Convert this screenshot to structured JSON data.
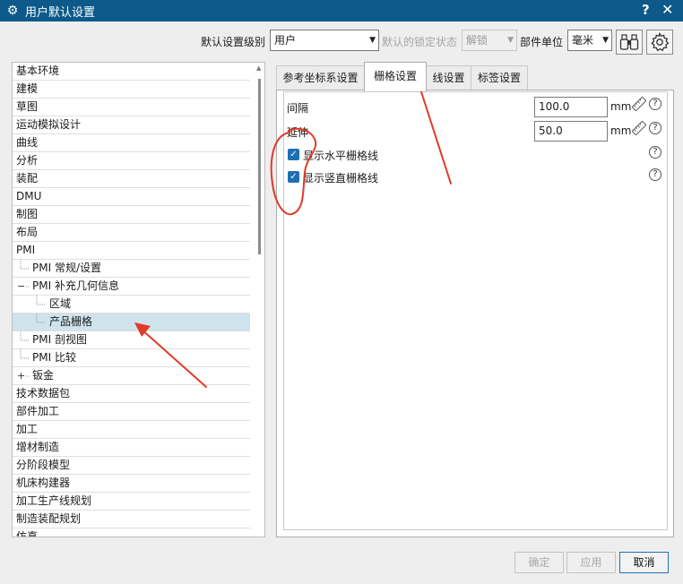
{
  "window": {
    "title": "用户默认设置",
    "title_icon": "gear-icon",
    "help": "?",
    "close": "✕"
  },
  "toolbar": {
    "level_label": "默认设置级别",
    "level_value": "用户",
    "lock_label": "默认的锁定状态",
    "lock_value": "解锁",
    "unit_label": "部件单位",
    "unit_value": "毫米",
    "find_icon": "binoculars-icon",
    "settings_icon": "gear-icon"
  },
  "tree": {
    "items": [
      {
        "label": "基本环境",
        "level": 0
      },
      {
        "label": "建模",
        "level": 0
      },
      {
        "label": "草图",
        "level": 0
      },
      {
        "label": "运动模拟设计",
        "level": 0
      },
      {
        "label": "曲线",
        "level": 0
      },
      {
        "label": "分析",
        "level": 0
      },
      {
        "label": "装配",
        "level": 0
      },
      {
        "label": "DMU",
        "level": 0
      },
      {
        "label": "制图",
        "level": 0
      },
      {
        "label": "布局",
        "level": 0
      },
      {
        "label": "PMI",
        "level": 0
      },
      {
        "label": "PMI 常规/设置",
        "level": 1
      },
      {
        "label": "PMI 补充几何信息",
        "level": 1,
        "expander": "−"
      },
      {
        "label": "区域",
        "level": 2
      },
      {
        "label": "产品栅格",
        "level": 2,
        "selected": true
      },
      {
        "label": "PMI 剖视图",
        "level": 1
      },
      {
        "label": "PMI 比较",
        "level": 1
      },
      {
        "label": "钣金",
        "level": 1,
        "expander": "+"
      },
      {
        "label": "技术数据包",
        "level": 0
      },
      {
        "label": "部件加工",
        "level": 0
      },
      {
        "label": "加工",
        "level": 0
      },
      {
        "label": "增材制造",
        "level": 0
      },
      {
        "label": "分阶段模型",
        "level": 0
      },
      {
        "label": "机床构建器",
        "level": 0
      },
      {
        "label": "加工生产线规划",
        "level": 0
      },
      {
        "label": "制造装配规划",
        "level": 0
      },
      {
        "label": "仿真",
        "level": 0
      }
    ]
  },
  "tabs": [
    {
      "label": "参考坐标系设置",
      "active": false
    },
    {
      "label": "栅格设置",
      "active": true
    },
    {
      "label": "线设置",
      "active": false
    },
    {
      "label": "标签设置",
      "active": false
    }
  ],
  "grid": {
    "interval_label": "间隔",
    "interval_value": "100.0",
    "extend_label": "延伸",
    "extend_value": "50.0",
    "unit": "mm",
    "help": "?",
    "show_horizontal_label": "显示水平栅格线",
    "show_horizontal_checked": true,
    "show_vertical_label": "显示竖直栅格线",
    "show_vertical_checked": true
  },
  "footer": {
    "ok": "确定",
    "apply": "应用",
    "cancel": "取消"
  },
  "annotation_color": "#e03a28",
  "accent_color": "#0d5a8a"
}
